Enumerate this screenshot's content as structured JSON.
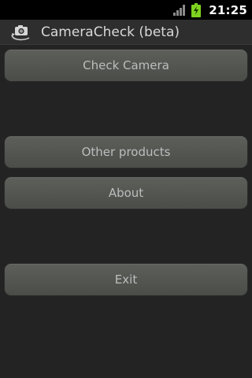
{
  "status_bar": {
    "time": "21:25",
    "icons": [
      "signal-icon",
      "battery-charging-icon"
    ]
  },
  "header": {
    "title": "CameraCheck (beta)",
    "icon": "camera-rotate-icon"
  },
  "buttons": {
    "check_camera": "Check Camera",
    "other_products": "Other products",
    "about": "About",
    "exit": "Exit"
  },
  "colors": {
    "background": "#232323",
    "status_bar": "#000000",
    "battery": "#7fd320",
    "button": "#55574f",
    "button_text": "#bdbdbd"
  }
}
